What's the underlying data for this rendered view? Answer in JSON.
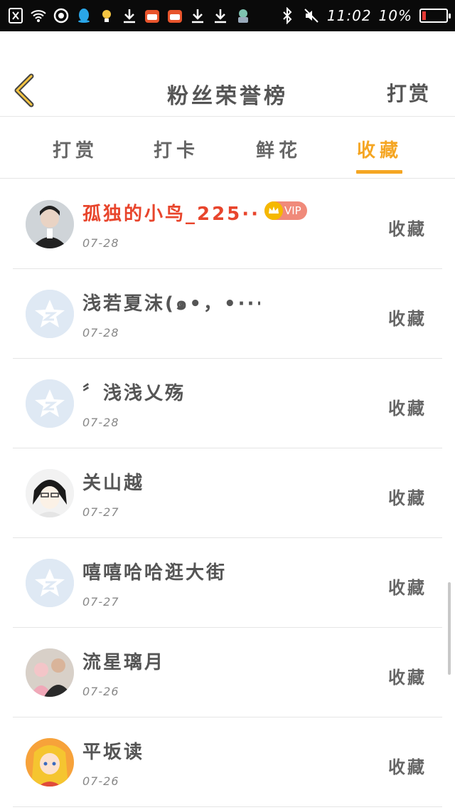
{
  "status_bar": {
    "time": "11:02",
    "battery": "10%",
    "battery_level": 0.1,
    "left_icons": [
      "close-box-icon",
      "wifi-icon",
      "circle-icon",
      "qq-icon",
      "bulb-icon",
      "download-icon",
      "app-icon",
      "app-icon",
      "download-icon",
      "download-icon",
      "game-icon"
    ],
    "right_icons": [
      "bluetooth-icon",
      "mute-icon"
    ]
  },
  "header": {
    "title": "粉丝荣誉榜",
    "action": "打赏"
  },
  "tabs": [
    {
      "label": "打赏",
      "active": false
    },
    {
      "label": "打卡",
      "active": false
    },
    {
      "label": "鲜花",
      "active": false
    },
    {
      "label": "收藏",
      "active": true
    }
  ],
  "list": [
    {
      "name": "孤独的小鸟_225···",
      "date": "07-28",
      "action": "收藏",
      "vip": true,
      "vip_label": "VIP",
      "avatar": "photo"
    },
    {
      "name": "浅若夏沫(๑•，•···",
      "date": "07-28",
      "action": "收藏",
      "vip": false,
      "avatar": "default"
    },
    {
      "name": "〞浅浅乂殇",
      "date": "07-28",
      "action": "收藏",
      "vip": false,
      "avatar": "default"
    },
    {
      "name": "关山越",
      "date": "07-27",
      "action": "收藏",
      "vip": false,
      "avatar": "anime"
    },
    {
      "name": "嘻嘻哈哈逛大街",
      "date": "07-27",
      "action": "收藏",
      "vip": false,
      "avatar": "default"
    },
    {
      "name": "流星璃月",
      "date": "07-26",
      "action": "收藏",
      "vip": false,
      "avatar": "photo2"
    },
    {
      "name": "平坂读",
      "date": "07-26",
      "action": "收藏",
      "vip": false,
      "avatar": "anime2"
    }
  ],
  "colors": {
    "accent": "#f5a623",
    "vip_name": "#e8452c",
    "vip_badge": "#f08a7a"
  }
}
